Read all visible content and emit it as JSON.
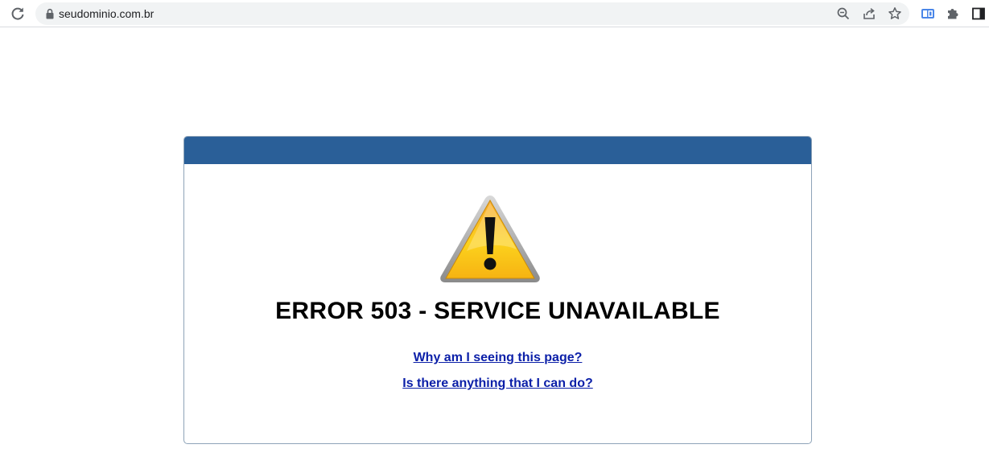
{
  "browser": {
    "url": "seudominio.com.br",
    "icons": {
      "reload": "reload-icon",
      "lock": "lock-icon",
      "zoom": "zoom-icon",
      "share": "share-icon",
      "bookmark": "star-icon",
      "extension_tab": "tab-extension-icon",
      "extensions": "puzzle-icon",
      "side_panel": "side-panel-icon"
    }
  },
  "error_page": {
    "header_color": "#2a5f98",
    "warning_icon": "warning-triangle-icon",
    "title": "ERROR 503 - SERVICE UNAVAILABLE",
    "links": [
      "Why am I seeing this page?",
      "Is there anything that I can do?"
    ],
    "link_color": "#0b1fa8"
  }
}
